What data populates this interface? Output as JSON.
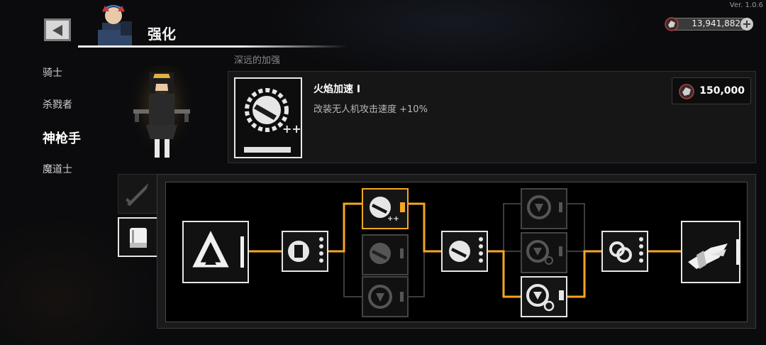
{
  "app": {
    "version": "Ver. 1.0.6"
  },
  "header": {
    "title": "强化"
  },
  "currency": {
    "amount": "13,941,882"
  },
  "classes": [
    {
      "label": "骑士",
      "active": false
    },
    {
      "label": "杀戮者",
      "active": false
    },
    {
      "label": "神枪手",
      "active": true
    },
    {
      "label": "魔道士",
      "active": false
    }
  ],
  "panel": {
    "subtitle": "深远的加强"
  },
  "selected_skill": {
    "name": "火焰加速 I",
    "description": "改装无人机攻击速度 +10%",
    "cost": "150,000"
  },
  "tabs": [
    {
      "icon": "sword-icon",
      "active": false
    },
    {
      "icon": "book-icon",
      "active": true
    }
  ],
  "colors": {
    "accent": "#f5a623",
    "line_inactive": "#3c3c3c",
    "node_border": "#e6e6e6"
  }
}
